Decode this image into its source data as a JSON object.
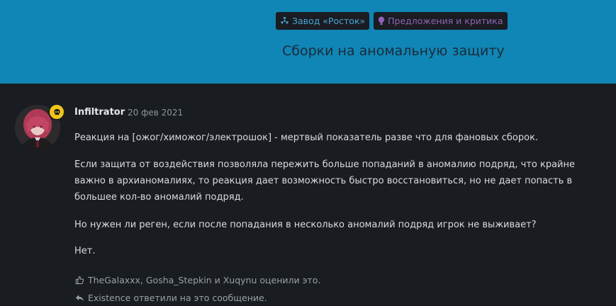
{
  "header": {
    "tags": [
      {
        "label": "Завод «Росток»",
        "icon": "radiation-icon"
      },
      {
        "label": "Предложения и критика",
        "icon": "lightbulb-icon"
      }
    ],
    "title": "Сборки на аномальную защиту"
  },
  "post": {
    "author": "Infiltrator",
    "date": "20 фев 2021",
    "paragraphs": [
      "Реакция на [ожог/химожог/электрошок] - мертвый показатель разве что для фановых сборок.",
      "Если защита от воздействия позволяла пережить больше попаданий в аномалию подряд, что крайне важно в архианомалиях, то реакция дает возможность быстро восстановиться, но не дает попасть в большее кол-во аномалий подряд.",
      "Но нужен ли реген, если после попадания в несколько аномалий подряд игрок не выживает?",
      "Нет."
    ],
    "likes_text": "TheGalaxxx, Gosha_Stepkin и Xuqynu оценили это.",
    "replies_text": "Existence ответили на это сообщение."
  },
  "colors": {
    "header_bg": "#0f86b5",
    "page_bg": "#191c20",
    "badge_bg": "#f0c419"
  }
}
